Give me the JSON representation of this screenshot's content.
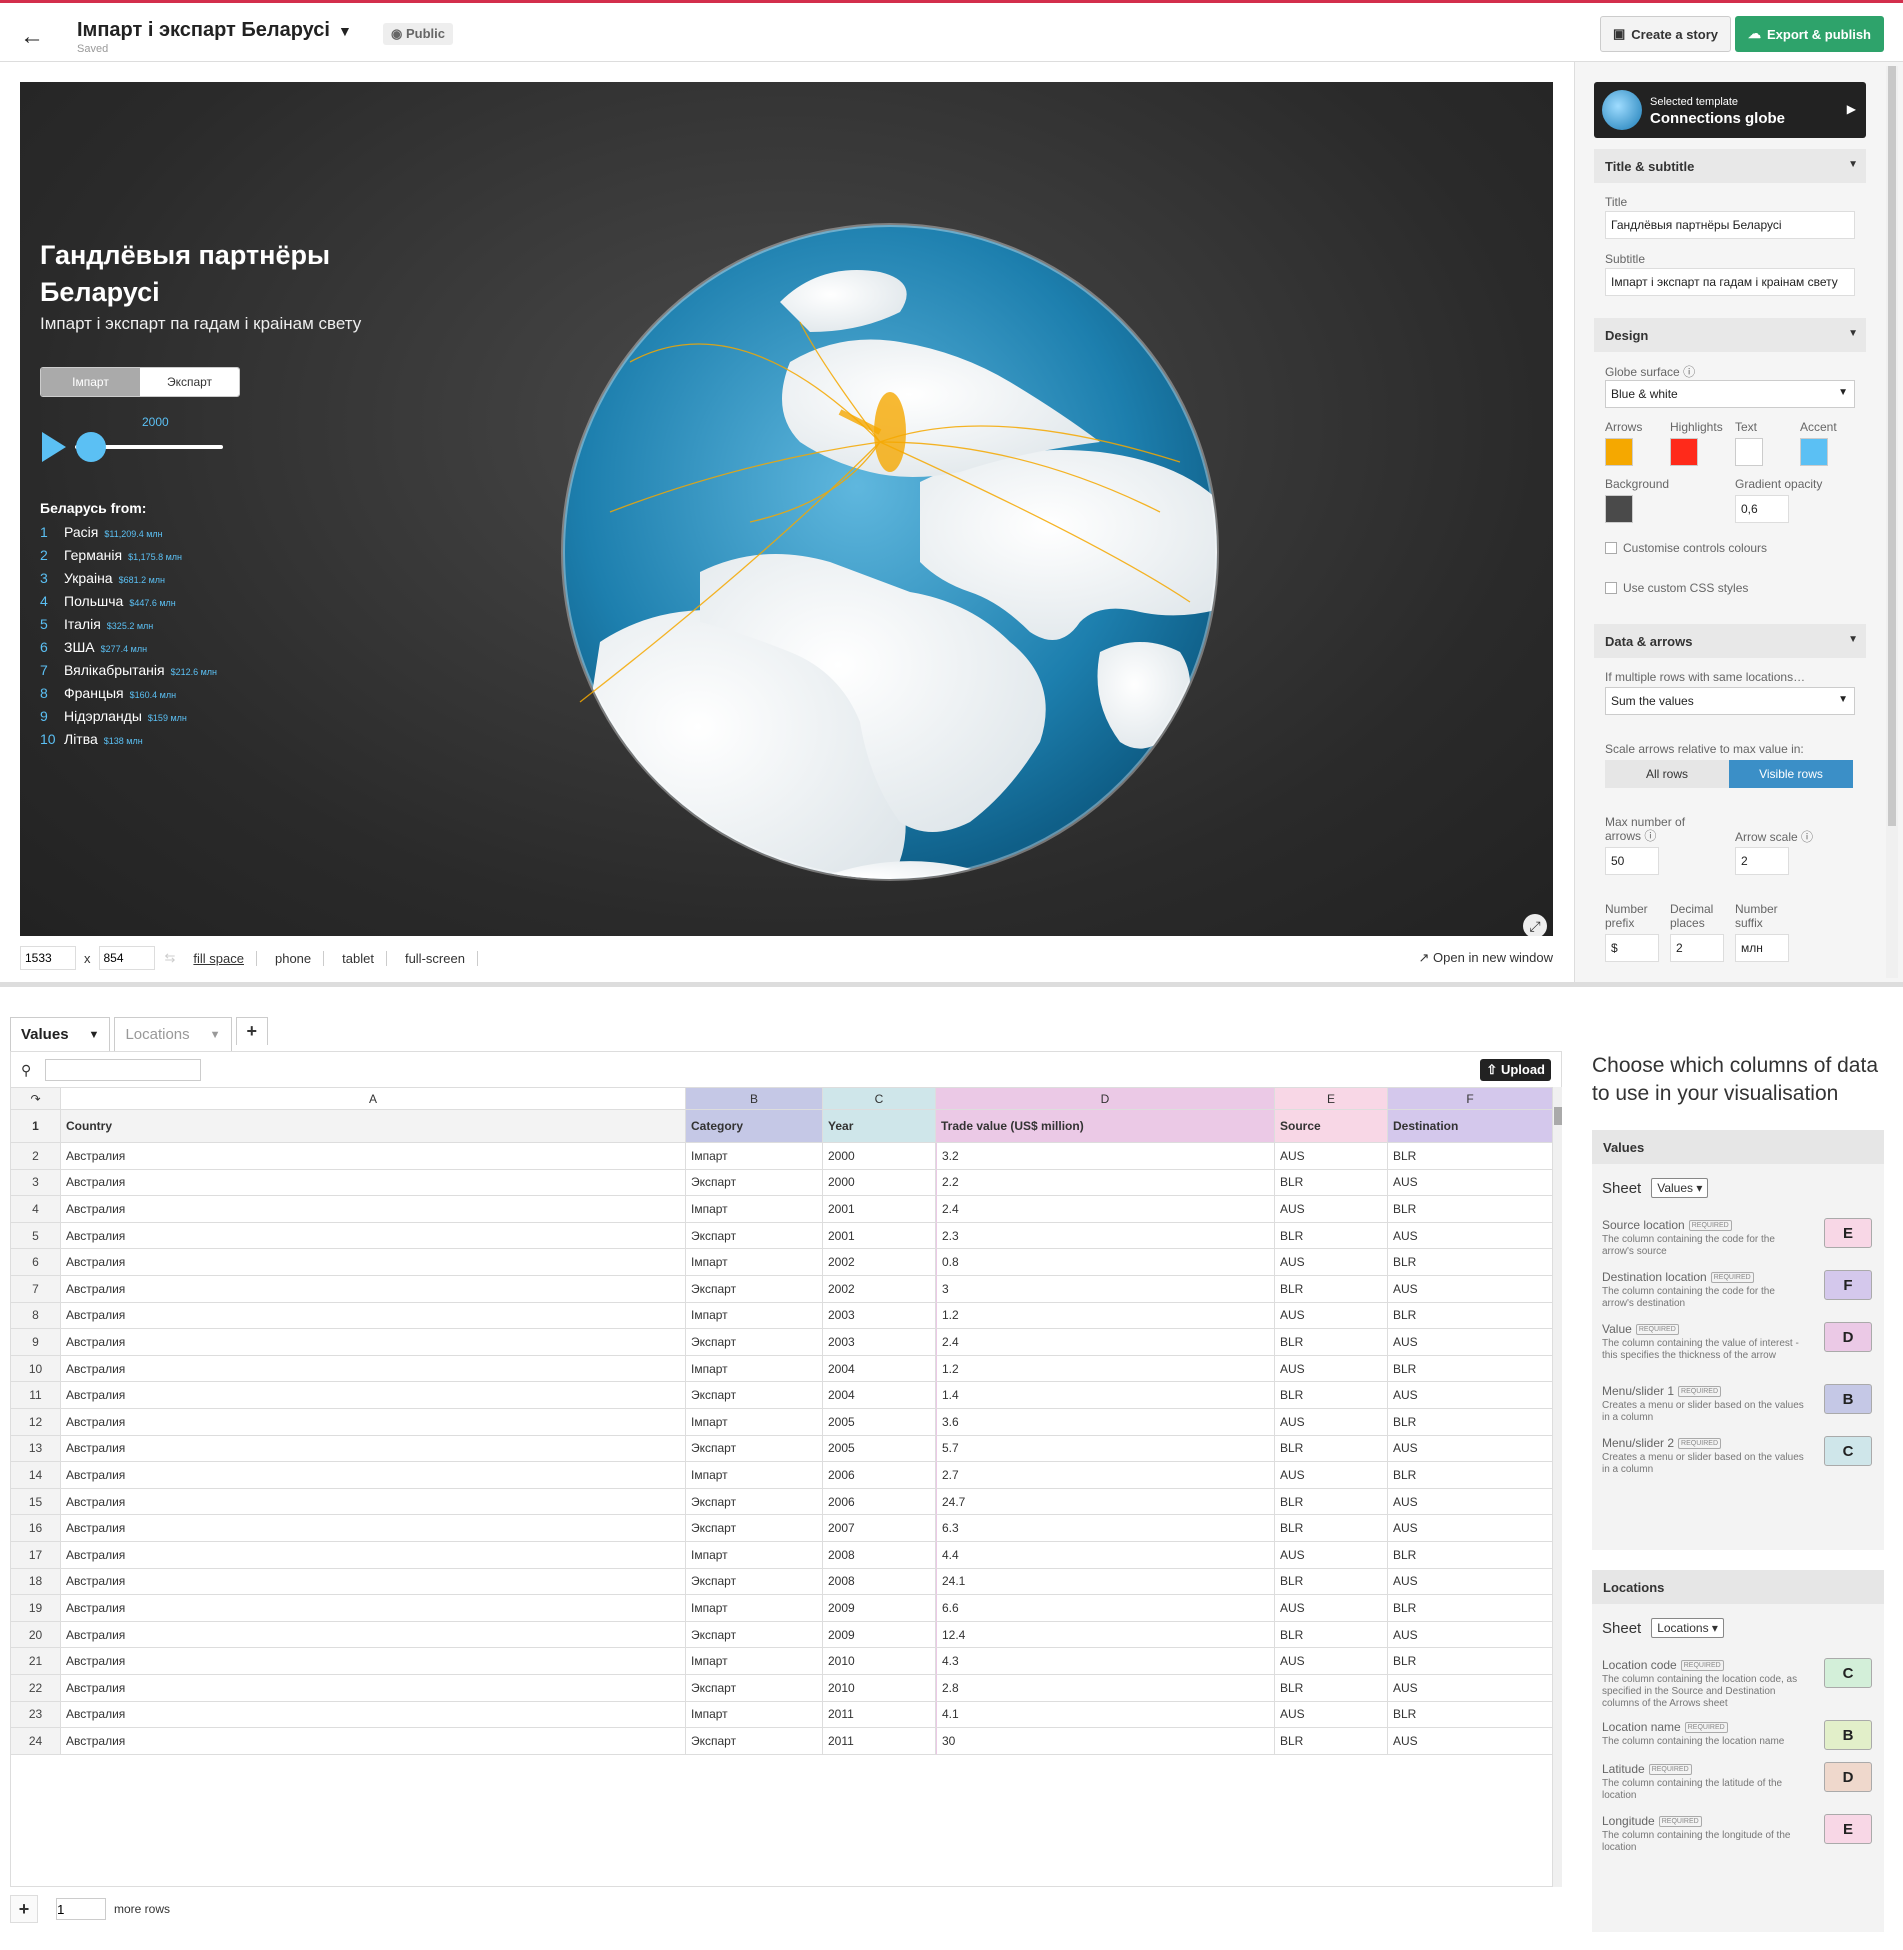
{
  "topbar": {
    "title": "Імпарт і экспарт Беларусі",
    "saved": "Saved",
    "public": "Public",
    "create_story": "Create a story",
    "export_publish": "Export & publish"
  },
  "vis": {
    "title": "Гандлёвыя партнёры Беларусі",
    "subtitle": "Імпарт і экспарт па гадам і краінам свету",
    "toggle": [
      "Імпарт",
      "Экспарт"
    ],
    "year": "2000",
    "rank_heading": "Беларусь from:",
    "ranking": [
      {
        "n": "1",
        "name": "Расія",
        "value": "$11,209.4 млн"
      },
      {
        "n": "2",
        "name": "Германія",
        "value": "$1,175.8 млн"
      },
      {
        "n": "3",
        "name": "Украіна",
        "value": "$681.2 млн"
      },
      {
        "n": "4",
        "name": "Польшча",
        "value": "$447.6 млн"
      },
      {
        "n": "5",
        "name": "Італія",
        "value": "$325.2 млн"
      },
      {
        "n": "6",
        "name": "ЗША",
        "value": "$277.4 млн"
      },
      {
        "n": "7",
        "name": "Вялікабрытанія",
        "value": "$212.6 млн"
      },
      {
        "n": "8",
        "name": "Францыя",
        "value": "$160.4 млн"
      },
      {
        "n": "9",
        "name": "Нідэрланды",
        "value": "$159 млн"
      },
      {
        "n": "10",
        "name": "Літва",
        "value": "$138 млн"
      }
    ]
  },
  "sizebar": {
    "width": "1533",
    "x": "x",
    "height": "854",
    "fill_space": "fill space",
    "phone": "phone",
    "tablet": "tablet",
    "full_screen": "full-screen",
    "open_new": "Open in new window"
  },
  "panel": {
    "template_label": "Selected template",
    "template_name": "Connections globe",
    "sec_title": "Title & subtitle",
    "title_label": "Title",
    "title_value": "Гандлёвыя партнёры Беларусі",
    "subtitle_label": "Subtitle",
    "subtitle_value": "Імпарт і экспарт па гадам і краінам свету",
    "sec_design": "Design",
    "globe_surface_label": "Globe surface",
    "globe_surface_value": "Blue & white",
    "arrows_label": "Arrows",
    "highlights_label": "Highlights",
    "text_label": "Text",
    "accent_label": "Accent",
    "background_label": "Background",
    "gradient_label": "Gradient opacity",
    "gradient_value": "0,6",
    "custom_controls": "Customise controls colours",
    "custom_css": "Use custom CSS styles",
    "sec_data": "Data & arrows",
    "multiple_rows_label": "If multiple rows with same locations…",
    "multiple_rows_value": "Sum the values",
    "scale_label": "Scale arrows relative to max value in:",
    "all_rows": "All rows",
    "visible_rows": "Visible rows",
    "max_arrows_label": "Max number of arrows",
    "max_arrows_value": "50",
    "arrow_scale_label": "Arrow scale",
    "arrow_scale_value": "2",
    "prefix_label": "Number prefix",
    "prefix_value": "$",
    "decimal_label": "Decimal places",
    "decimal_value": "2",
    "suffix_label": "Number suffix",
    "suffix_value": "млн"
  },
  "colors": {
    "arrows": "#f5a800",
    "highlights": "#ff2a1a",
    "text": "#ffffff",
    "accent": "#5bc0f4",
    "background": "#4a4a4a",
    "export_green": "#2ea36b",
    "visible_rows": "#3b8fc7",
    "colB": "#c5c8e6",
    "colC": "#cfe6ea",
    "colD": "#ebc9e6",
    "colE": "#f8d7e6",
    "colF": "#d4c8ec"
  },
  "grid": {
    "tabs": [
      "Values",
      "Locations"
    ],
    "upload": "Upload",
    "col_letters": [
      "A",
      "B",
      "C",
      "D",
      "E",
      "F"
    ],
    "headers": [
      "Country",
      "Category",
      "Year",
      "Trade value (US$ million)",
      "Source",
      "Destination"
    ],
    "rows": [
      [
        "2",
        "Австралия",
        "Імпарт",
        "2000",
        "3.2",
        "AUS",
        "BLR"
      ],
      [
        "3",
        "Австралия",
        "Экспарт",
        "2000",
        "2.2",
        "BLR",
        "AUS"
      ],
      [
        "4",
        "Австралия",
        "Імпарт",
        "2001",
        "2.4",
        "AUS",
        "BLR"
      ],
      [
        "5",
        "Австралия",
        "Экспарт",
        "2001",
        "2.3",
        "BLR",
        "AUS"
      ],
      [
        "6",
        "Австралия",
        "Імпарт",
        "2002",
        "0.8",
        "AUS",
        "BLR"
      ],
      [
        "7",
        "Австралия",
        "Экспарт",
        "2002",
        "3",
        "BLR",
        "AUS"
      ],
      [
        "8",
        "Австралия",
        "Імпарт",
        "2003",
        "1.2",
        "AUS",
        "BLR"
      ],
      [
        "9",
        "Австралия",
        "Экспарт",
        "2003",
        "2.4",
        "BLR",
        "AUS"
      ],
      [
        "10",
        "Австралия",
        "Імпарт",
        "2004",
        "1.2",
        "AUS",
        "BLR"
      ],
      [
        "11",
        "Австралия",
        "Экспарт",
        "2004",
        "1.4",
        "BLR",
        "AUS"
      ],
      [
        "12",
        "Австралия",
        "Імпарт",
        "2005",
        "3.6",
        "AUS",
        "BLR"
      ],
      [
        "13",
        "Австралия",
        "Экспарт",
        "2005",
        "5.7",
        "BLR",
        "AUS"
      ],
      [
        "14",
        "Австралия",
        "Імпарт",
        "2006",
        "2.7",
        "AUS",
        "BLR"
      ],
      [
        "15",
        "Австралия",
        "Экспарт",
        "2006",
        "24.7",
        "BLR",
        "AUS"
      ],
      [
        "16",
        "Австралия",
        "Экспарт",
        "2007",
        "6.3",
        "BLR",
        "AUS"
      ],
      [
        "17",
        "Австралия",
        "Імпарт",
        "2008",
        "4.4",
        "AUS",
        "BLR"
      ],
      [
        "18",
        "Австралия",
        "Экспарт",
        "2008",
        "24.1",
        "BLR",
        "AUS"
      ],
      [
        "19",
        "Австралия",
        "Імпарт",
        "2009",
        "6.6",
        "AUS",
        "BLR"
      ],
      [
        "20",
        "Австралия",
        "Экспарт",
        "2009",
        "12.4",
        "BLR",
        "AUS"
      ],
      [
        "21",
        "Австралия",
        "Імпарт",
        "2010",
        "4.3",
        "AUS",
        "BLR"
      ],
      [
        "22",
        "Австралия",
        "Экспарт",
        "2010",
        "2.8",
        "BLR",
        "AUS"
      ],
      [
        "23",
        "Австралия",
        "Імпарт",
        "2011",
        "4.1",
        "AUS",
        "BLR"
      ],
      [
        "24",
        "Австралия",
        "Экспарт",
        "2011",
        "30",
        "BLR",
        "AUS"
      ]
    ],
    "more_rows_value": "1",
    "more_rows": "more rows"
  },
  "bindings": {
    "heading": "Choose which columns of data to use in your visualisation",
    "values_title": "Values",
    "sheet_label": "Sheet",
    "values_sheet": "Values",
    "locations_title": "Locations",
    "locations_sheet": "Locations",
    "required": "REQUIRED",
    "values_items": [
      {
        "t": "Source location",
        "d": "The column containing the code for the arrow's source",
        "col": "E"
      },
      {
        "t": "Destination location",
        "d": "The column containing the code for the arrow's destination",
        "col": "F"
      },
      {
        "t": "Value",
        "d": "The column containing the value of interest - this specifies the thickness of the arrow",
        "col": "D"
      },
      {
        "t": "Menu/slider 1",
        "d": "Creates a menu or slider based on the values in a column",
        "col": "B"
      },
      {
        "t": "Menu/slider 2",
        "d": "Creates a menu or slider based on the values in a column",
        "col": "C"
      }
    ],
    "locations_items": [
      {
        "t": "Location code",
        "d": "The column containing the location code, as specified in the Source and Destination columns of the Arrows sheet",
        "col": "C"
      },
      {
        "t": "Location name",
        "d": "The column containing the location name",
        "col": "B"
      },
      {
        "t": "Latitude",
        "d": "The column containing the latitude of the location",
        "col": "D"
      },
      {
        "t": "Longitude",
        "d": "The column containing the longitude of the location",
        "col": "E"
      }
    ]
  }
}
